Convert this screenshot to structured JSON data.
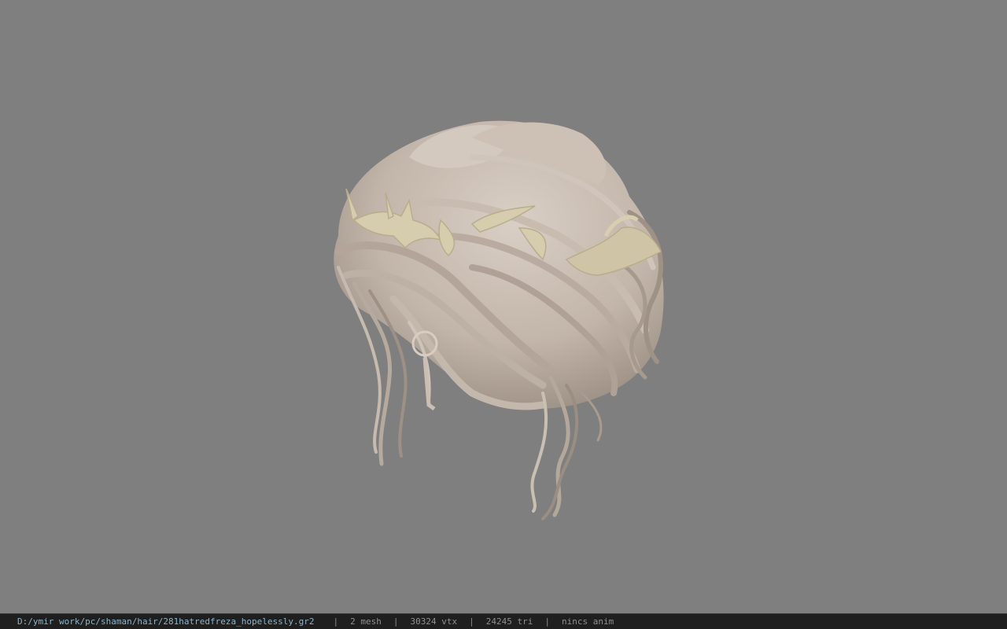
{
  "status_bar": {
    "file_path": "D:/ymir work/pc/shaman/hair/281hatredfreza_hopelessly.gr2",
    "separator": "|",
    "mesh": "2 mesh",
    "vertices": "30324 vtx",
    "triangles": "24245 tri",
    "anim": "nincs anim"
  },
  "colors": {
    "viewport_bg": "#7f7f7f",
    "statusbar_bg": "#1f1f1f",
    "path_text": "#8fb3c9",
    "stat_text": "#8f8f8f",
    "hair": "#cbbfb4",
    "ornament": "#d6cdae"
  },
  "model": {
    "icon": "hair-model-3d",
    "description_visible": false
  }
}
